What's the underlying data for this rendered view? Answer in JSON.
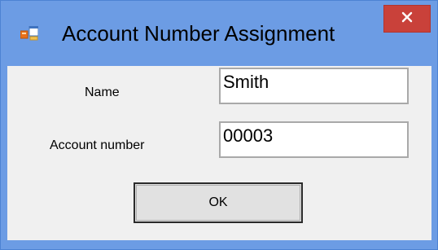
{
  "window": {
    "title": "Account Number Assignment",
    "title_bar_color": "#6c9ce4",
    "close_button_color": "#c9413a",
    "close_glyph": "×"
  },
  "form": {
    "name_label": "Name",
    "name_value": "Smith",
    "account_label": "Account number",
    "account_value": "00003"
  },
  "buttons": {
    "ok_label": "OK"
  },
  "icons": {
    "app": "form-window-icon",
    "close": "close-icon"
  }
}
